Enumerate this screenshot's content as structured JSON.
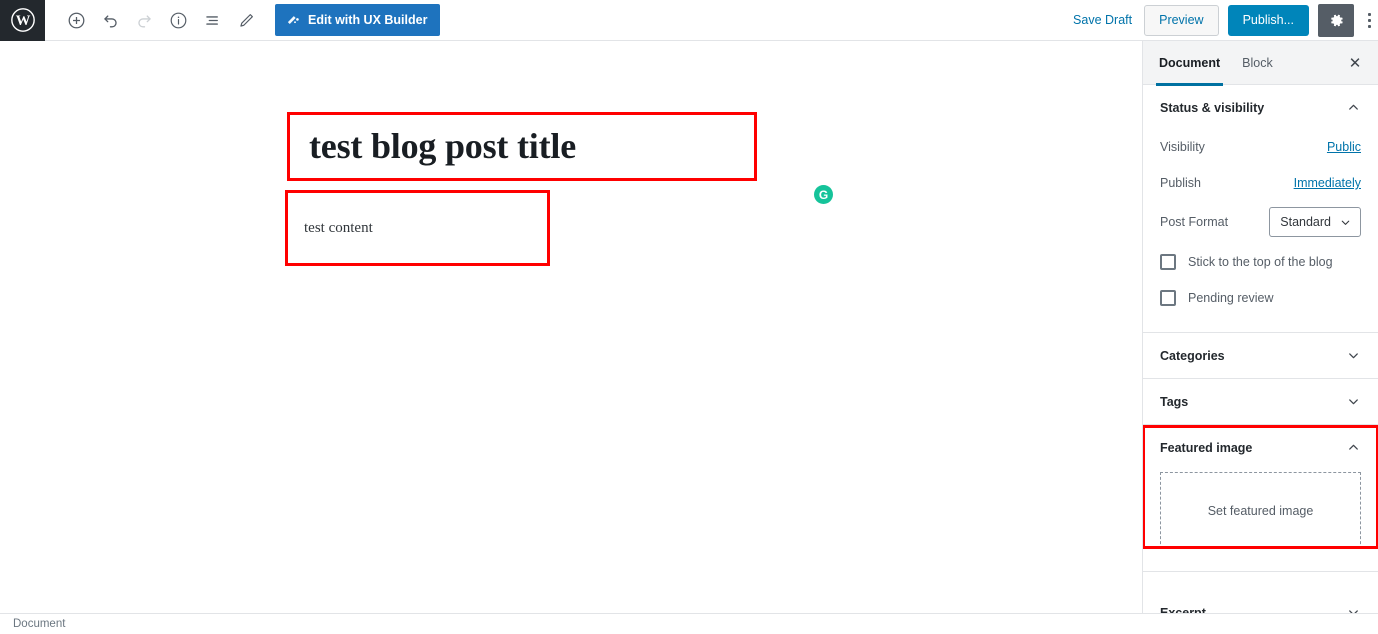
{
  "toolbar": {
    "logo_icon": "wordpress-logo-icon",
    "left_tools": [
      {
        "icon": "add-block-icon",
        "label": "Add block",
        "disabled": false
      },
      {
        "icon": "undo-icon",
        "label": "Undo",
        "disabled": false
      },
      {
        "icon": "redo-icon",
        "label": "Redo",
        "disabled": true
      },
      {
        "icon": "info-icon",
        "label": "Content structure",
        "disabled": false
      },
      {
        "icon": "list-view-icon",
        "label": "Block navigation",
        "disabled": false
      },
      {
        "icon": "pencil-icon",
        "label": "Edit",
        "disabled": false
      }
    ],
    "ux_builder_label": "Edit with UX Builder",
    "ux_builder_icon": "ux-builder-icon",
    "save_draft_label": "Save Draft",
    "preview_label": "Preview",
    "publish_label": "Publish...",
    "settings_icon": "gear-icon",
    "more_icon": "more-vertical-icon",
    "accent_blue": "#0085ba",
    "ux_blue": "#1e73be",
    "gear_gray": "#555d66",
    "logo_dark": "#23282d"
  },
  "editor": {
    "post_title": "test blog post title",
    "post_content": "test content",
    "grammarly_letter": "G",
    "grammarly_color": "#15c39a",
    "highlight_color": "#ff0000"
  },
  "sidebar": {
    "tabs": [
      {
        "label": "Document",
        "active": true
      },
      {
        "label": "Block",
        "active": false
      }
    ],
    "close_icon": "close-icon",
    "close_glyph": "✕",
    "panels": {
      "status_visibility": {
        "title": "Status & visibility",
        "expanded": true,
        "chevron": "chevron-up-icon",
        "visibility_label": "Visibility",
        "visibility_value": "Public",
        "publish_label": "Publish",
        "publish_value": "Immediately",
        "post_format_label": "Post Format",
        "post_format_value": "Standard",
        "sticky_label": "Stick to the top of the blog",
        "sticky_checked": false,
        "pending_label": "Pending review",
        "pending_checked": false
      },
      "categories": {
        "title": "Categories",
        "expanded": false,
        "chevron": "chevron-down-icon"
      },
      "tags": {
        "title": "Tags",
        "expanded": false,
        "chevron": "chevron-down-icon"
      },
      "featured_image": {
        "title": "Featured image",
        "expanded": true,
        "chevron": "chevron-up-icon",
        "set_image_label": "Set featured image",
        "highlighted": true
      },
      "excerpt": {
        "title": "Excerpt",
        "expanded": false,
        "chevron": "chevron-down-icon"
      }
    }
  },
  "statusbar": {
    "label": "Document"
  }
}
